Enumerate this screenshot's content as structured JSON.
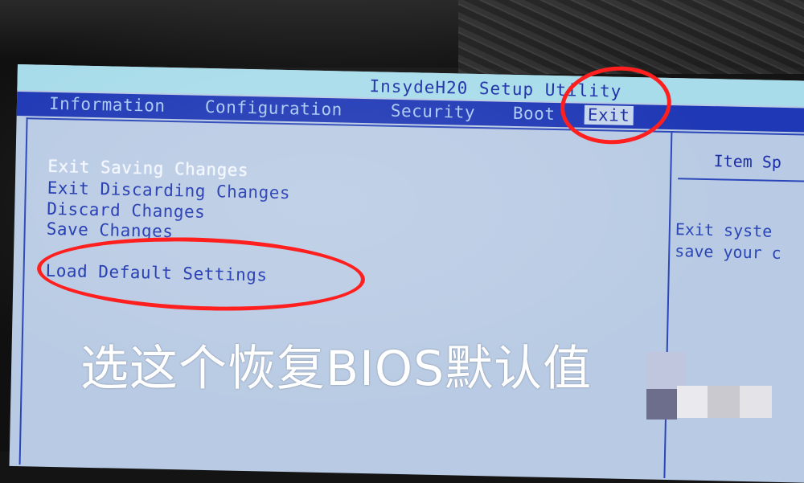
{
  "bios": {
    "title": "InsydeH20 Setup Utility",
    "menu": [
      {
        "label": "Information"
      },
      {
        "label": "Configuration"
      },
      {
        "label": "Security"
      },
      {
        "label": "Boot"
      },
      {
        "label": "Exit",
        "active": true
      }
    ],
    "options": [
      {
        "label": "Exit Saving Changes",
        "selected": true
      },
      {
        "label": "Exit Discarding Changes"
      },
      {
        "label": "Discard Changes"
      },
      {
        "label": "Save Changes"
      },
      {
        "label": "Load Default Settings"
      }
    ],
    "help_panel": {
      "title": "Item Sp",
      "lines": [
        "Exit syste",
        "save your c"
      ]
    }
  },
  "caption": "选这个恢复BIOS默认值",
  "colors": {
    "annotation": "#ff1f1f",
    "menu_bar": "#1f38b5",
    "screen_bg": "#b9cbe4"
  }
}
